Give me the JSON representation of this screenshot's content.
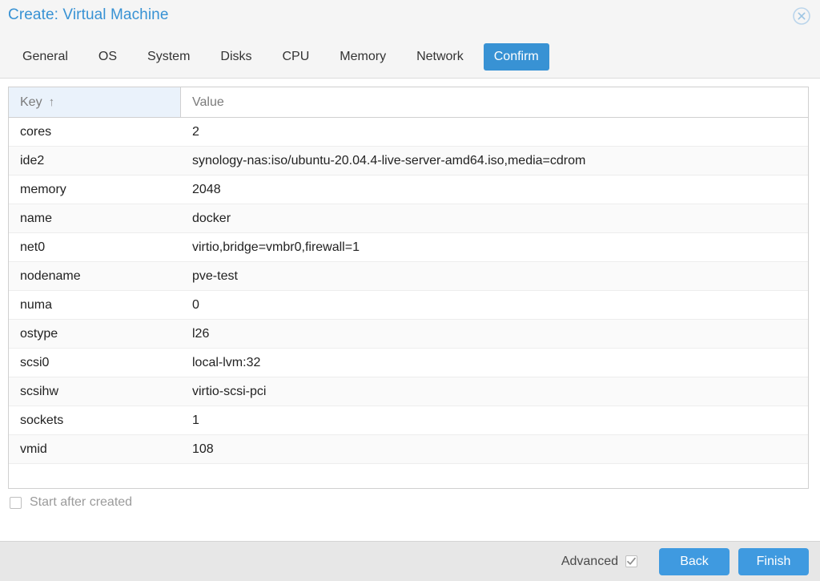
{
  "window": {
    "title": "Create: Virtual Machine",
    "close_icon": "close-circle-icon"
  },
  "tabs": [
    {
      "label": "General",
      "active": false
    },
    {
      "label": "OS",
      "active": false
    },
    {
      "label": "System",
      "active": false
    },
    {
      "label": "Disks",
      "active": false
    },
    {
      "label": "CPU",
      "active": false
    },
    {
      "label": "Memory",
      "active": false
    },
    {
      "label": "Network",
      "active": false
    },
    {
      "label": "Confirm",
      "active": true
    }
  ],
  "grid": {
    "columns": [
      {
        "label": "Key",
        "sorted": true,
        "sort_indicator": "↑",
        "sort_direction": "ascending"
      },
      {
        "label": "Value",
        "sorted": false,
        "sort_indicator": "",
        "sort_direction": ""
      }
    ],
    "rows": [
      {
        "key": "cores",
        "value": "2"
      },
      {
        "key": "ide2",
        "value": "synology-nas:iso/ubuntu-20.04.4-live-server-amd64.iso,media=cdrom"
      },
      {
        "key": "memory",
        "value": "2048"
      },
      {
        "key": "name",
        "value": "docker"
      },
      {
        "key": "net0",
        "value": "virtio,bridge=vmbr0,firewall=1"
      },
      {
        "key": "nodename",
        "value": "pve-test"
      },
      {
        "key": "numa",
        "value": "0"
      },
      {
        "key": "ostype",
        "value": "l26"
      },
      {
        "key": "scsi0",
        "value": "local-lvm:32"
      },
      {
        "key": "scsihw",
        "value": "virtio-scsi-pci"
      },
      {
        "key": "sockets",
        "value": "1"
      },
      {
        "key": "vmid",
        "value": "108"
      }
    ]
  },
  "options": {
    "start_after_created": {
      "label": "Start after created",
      "checked": false
    }
  },
  "footer": {
    "advanced": {
      "label": "Advanced",
      "checked": true
    },
    "back_label": "Back",
    "finish_label": "Finish"
  },
  "colors": {
    "accent_blue": "#3892d4",
    "button_blue": "#3f9ae0",
    "header_bg": "#f5f5f5",
    "footer_bg": "#e7e7e7",
    "sorted_col_bg": "#eaf2fb"
  }
}
